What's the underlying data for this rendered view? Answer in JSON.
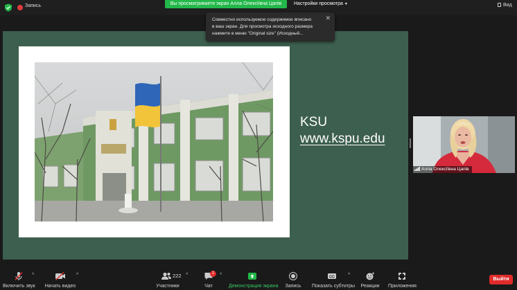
{
  "topbar": {
    "record_label": "Запись",
    "viewing_banner": "Вы просматриваете экран Алла Олексіївна Цапів",
    "view_options": "Настройки просмотра",
    "view_button": "Вид"
  },
  "tooltip": {
    "lines": [
      "Совместно используемое содержимое вписано",
      "в ваш экран. Для просмотра исходного размера",
      "нажмите в меню \"Original size\" (Исходный..."
    ]
  },
  "slide": {
    "title": "KSU",
    "url": "www.kspu.edu"
  },
  "participant": {
    "name": "Алла Олексіївна Цапів"
  },
  "toolbar": {
    "unmute": "Включить звук",
    "start_video": "Начать видео",
    "participants": "Участники",
    "participants_count": "222",
    "chat": "Чат",
    "chat_badge": "1",
    "share_screen": "Демонстрация экрана",
    "record": "Запись",
    "captions": "Показать субтитры",
    "captions_icon": "CC",
    "reactions": "Реакции",
    "apps": "Приложения",
    "leave": "Выйти"
  },
  "colors": {
    "accent_green": "#23b84a",
    "leave_red": "#e02b2b",
    "stage_bg": "#3d5f4f"
  }
}
